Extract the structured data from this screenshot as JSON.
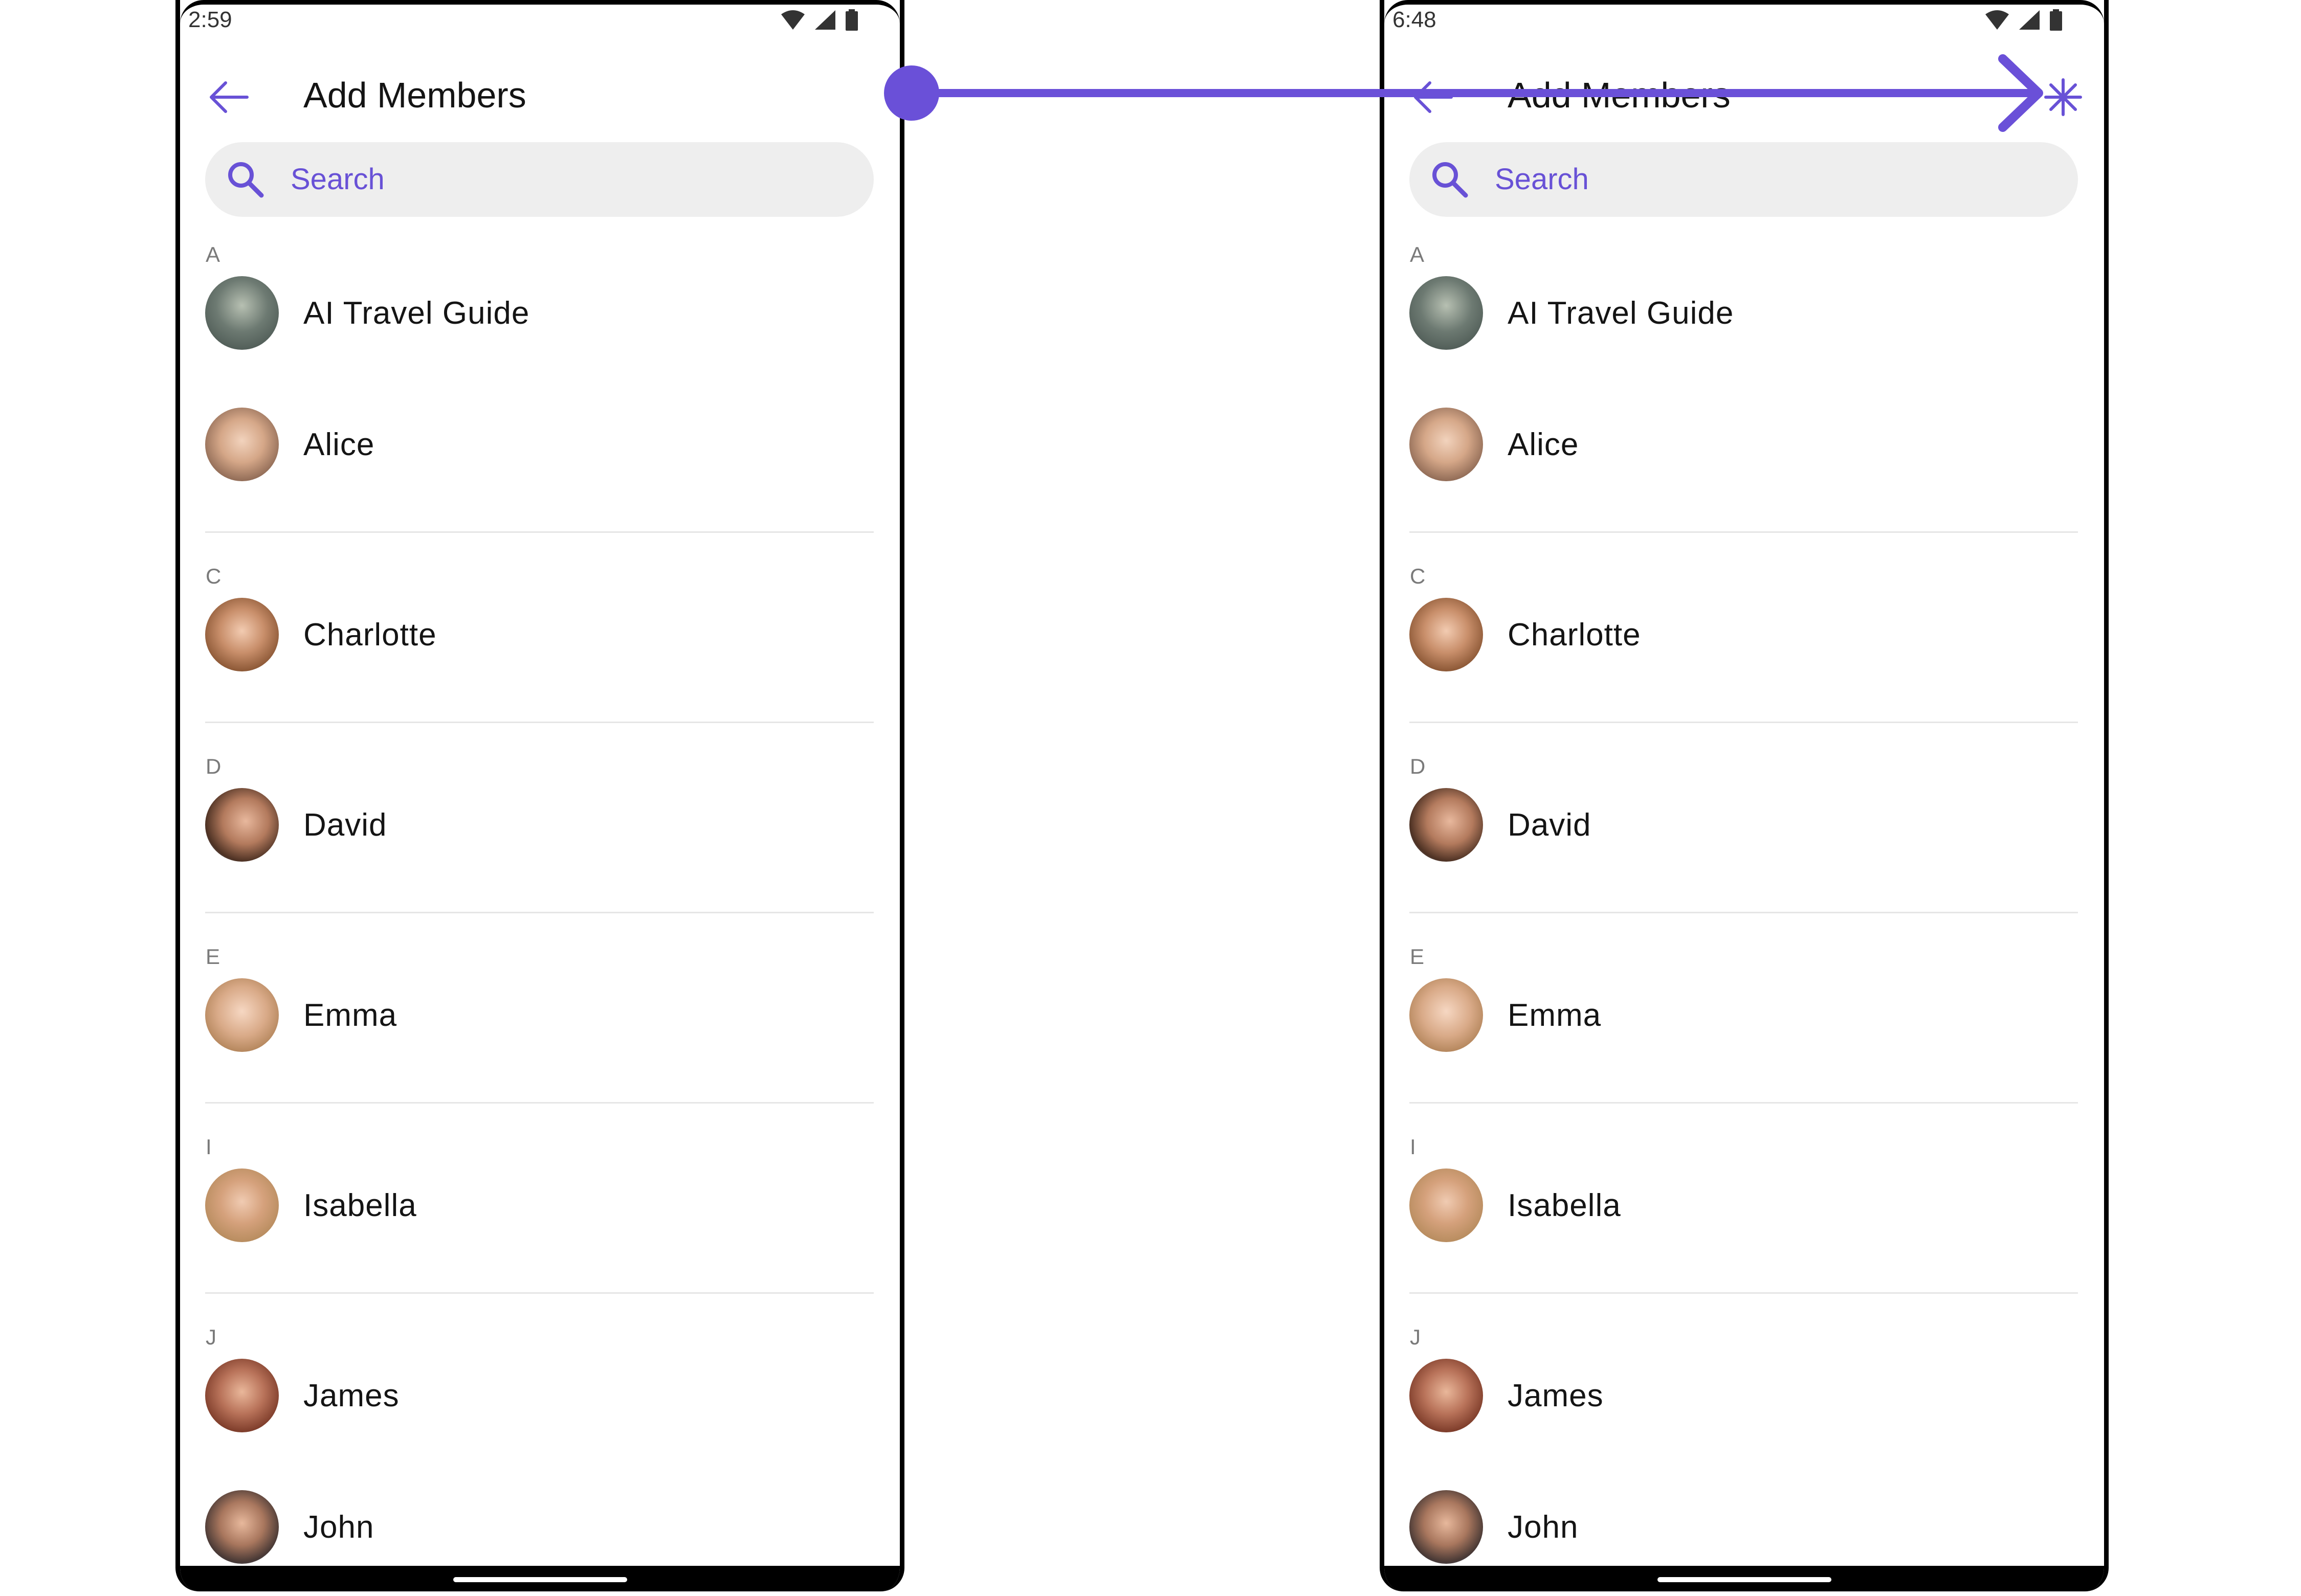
{
  "colors": {
    "accent": "#6851d6",
    "annotation": "#6a50d8",
    "search_bg": "#eeeeee",
    "divider": "#e6e6e6"
  },
  "screens": [
    {
      "status": {
        "time": "2:59"
      },
      "header": {
        "title": "Add Members",
        "back_icon": "arrow-left-icon"
      },
      "search": {
        "placeholder": "Search",
        "icon": "search-icon"
      },
      "sections": [
        {
          "letter": "A",
          "members": [
            "AI Travel Guide",
            "Alice"
          ]
        },
        {
          "letter": "C",
          "members": [
            "Charlotte"
          ]
        },
        {
          "letter": "D",
          "members": [
            "David"
          ]
        },
        {
          "letter": "E",
          "members": [
            "Emma"
          ]
        },
        {
          "letter": "I",
          "members": [
            "Isabella"
          ]
        },
        {
          "letter": "J",
          "members": [
            "James",
            "John"
          ]
        }
      ]
    },
    {
      "status": {
        "time": "6:48"
      },
      "header": {
        "title": "Add Members",
        "back_icon": "arrow-left-icon",
        "action_icon": "asterisk-icon"
      },
      "search": {
        "placeholder": "Search",
        "icon": "search-icon"
      },
      "sections": [
        {
          "letter": "A",
          "members": [
            "AI Travel Guide",
            "Alice"
          ]
        },
        {
          "letter": "C",
          "members": [
            "Charlotte"
          ]
        },
        {
          "letter": "D",
          "members": [
            "David"
          ]
        },
        {
          "letter": "E",
          "members": [
            "Emma"
          ]
        },
        {
          "letter": "I",
          "members": [
            "Isabella"
          ]
        },
        {
          "letter": "J",
          "members": [
            "James",
            "John"
          ]
        }
      ]
    }
  ]
}
